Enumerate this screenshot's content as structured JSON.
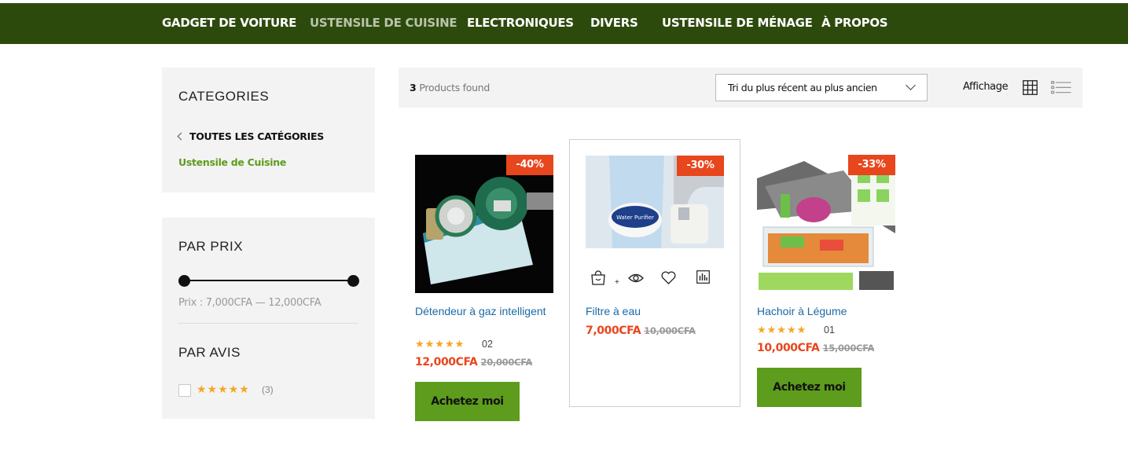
{
  "nav": {
    "items": [
      {
        "label": "GADGET DE VOITURE"
      },
      {
        "label": "USTENSILE DE CUISINE"
      },
      {
        "label": "ELECTRONIQUES"
      },
      {
        "label": "DIVERS"
      },
      {
        "label": "USTENSILE DE MÉNAGE"
      },
      {
        "label": "À PROPOS"
      }
    ],
    "active_index": 1,
    "background": "#2d4a0d"
  },
  "sidebar": {
    "categories": {
      "title": "CATEGORIES",
      "all_label": "TOUTES LES CATÉGORIES",
      "current_label": "Ustensile de Cuisine"
    },
    "price_filter": {
      "title": "PAR PRIX",
      "range_text": "Prix : 7,000CFA — 12,000CFA",
      "min": 7000,
      "max": 12000
    },
    "review_filter": {
      "title": "PAR AVIS",
      "stars": "★★★★★",
      "rating": 5,
      "count": "(3)"
    }
  },
  "toolbar": {
    "found_count": "3",
    "found_label": "Products found",
    "sort_selected": "Tri du plus récent au plus ancien",
    "view_label": "Affichage",
    "icons": [
      "grid-view-icon",
      "list-view-icon"
    ]
  },
  "products": [
    {
      "badge": "-40%",
      "name": "Détendeur à gaz intelligent",
      "stars": "★★★★★",
      "rating": 5,
      "review_count": "02",
      "price": "12,000CFA",
      "old_price": "20,000CFA",
      "button": "Achetez moi"
    },
    {
      "badge": "-30%",
      "name": "Filtre à eau",
      "price": "7,000CFA",
      "old_price": "10,000CFA",
      "action_icons": [
        "add-to-cart-icon",
        "quick-view-icon",
        "wishlist-icon",
        "compare-icon"
      ],
      "image_label": "Water Purifier"
    },
    {
      "badge": "-33%",
      "name": "Hachoir à Légume",
      "stars": "★★★★★",
      "rating": 5,
      "review_count": "01",
      "price": "10,000CFA",
      "old_price": "15,000CFA",
      "button": "Achetez moi"
    }
  ],
  "colors": {
    "accent_green": "#5d9c1c",
    "sale_red": "#e8461d",
    "link_blue": "#1a6aa8",
    "star": "#f5a623"
  }
}
